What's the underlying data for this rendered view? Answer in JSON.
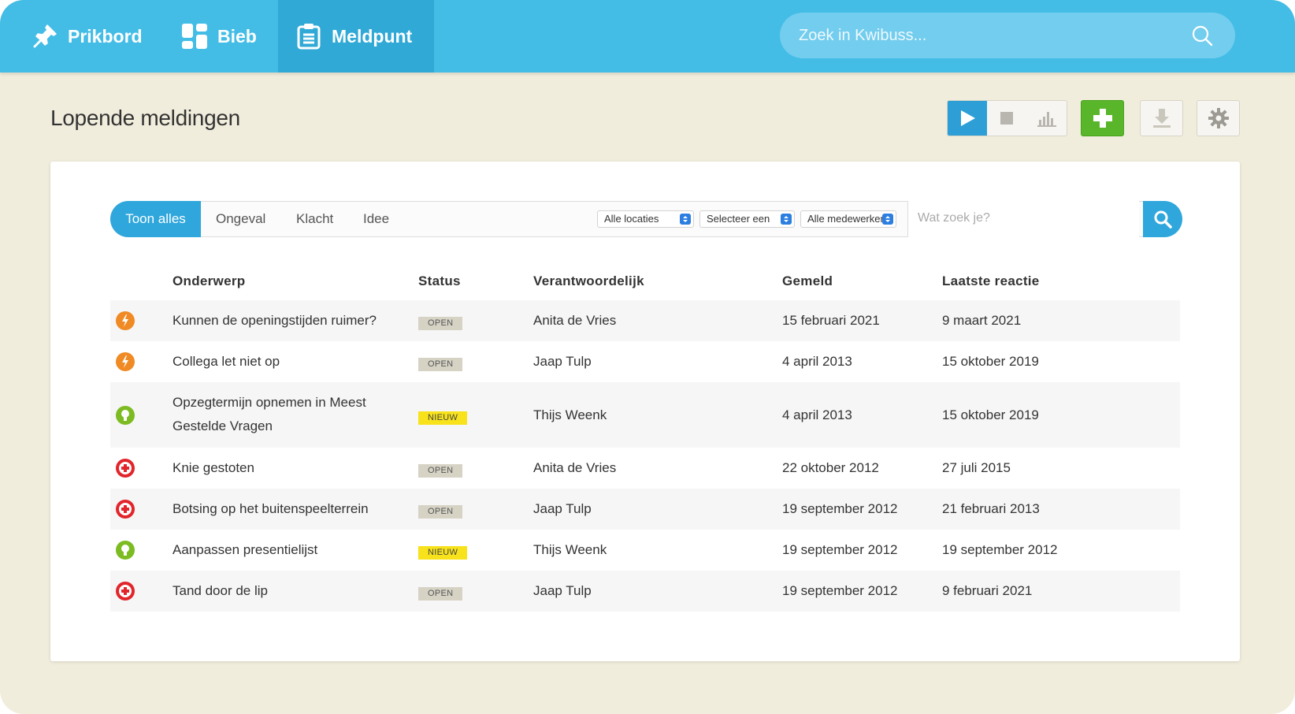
{
  "nav": {
    "items": [
      {
        "label": "Prikbord",
        "icon": "pushpin-icon"
      },
      {
        "label": "Bieb",
        "icon": "grid-icon"
      },
      {
        "label": "Meldpunt",
        "icon": "clipboard-icon",
        "active": true
      }
    ]
  },
  "search": {
    "placeholder": "Zoek in Kwibuss..."
  },
  "page": {
    "title": "Lopende meldingen"
  },
  "toolbar": {
    "view_buttons": [
      "play-icon",
      "stop-icon",
      "bar-chart-icon"
    ],
    "add_icon": "plus-icon",
    "download_icon": "download-icon",
    "settings_icon": "gear-icon"
  },
  "filters": {
    "tabs": [
      "Toon alles",
      "Ongeval",
      "Klacht",
      "Idee"
    ],
    "active_tab": "Toon alles",
    "selects": [
      "Alle locaties",
      "Selecteer een",
      "Alle medewerkers"
    ],
    "search_placeholder": "Wat zoek je?"
  },
  "table": {
    "headers": [
      "Onderwerp",
      "Status",
      "Verantwoordelijk",
      "Gemeld",
      "Laatste reactie"
    ],
    "rows": [
      {
        "type": "klacht",
        "subject": "Kunnen de openingstijden ruimer?",
        "status": "OPEN",
        "responsible": "Anita de Vries",
        "reported": "15 februari 2021",
        "last": "9 maart 2021"
      },
      {
        "type": "klacht",
        "subject": "Collega let niet op",
        "status": "OPEN",
        "responsible": "Jaap Tulp",
        "reported": "4 april 2013",
        "last": "15 oktober 2019"
      },
      {
        "type": "idee",
        "subject": "Opzegtermijn opnemen in Meest Gestelde Vragen",
        "status": "NIEUW",
        "responsible": "Thijs Weenk",
        "reported": "4 april 2013",
        "last": "15 oktober 2019"
      },
      {
        "type": "ongeval",
        "subject": "Knie gestoten",
        "status": "OPEN",
        "responsible": "Anita de Vries",
        "reported": "22 oktober 2012",
        "last": "27 juli 2015"
      },
      {
        "type": "ongeval",
        "subject": "Botsing op het buitenspeelterrein",
        "status": "OPEN",
        "responsible": "Jaap Tulp",
        "reported": "19 september 2012",
        "last": "21 februari 2013"
      },
      {
        "type": "idee",
        "subject": "Aanpassen presentielijst",
        "status": "NIEUW",
        "responsible": "Thijs Weenk",
        "reported": "19 september 2012",
        "last": "19 september 2012"
      },
      {
        "type": "ongeval",
        "subject": "Tand door de lip",
        "status": "OPEN",
        "responsible": "Jaap Tulp",
        "reported": "19 september 2012",
        "last": "9 februari 2021"
      }
    ]
  },
  "colors": {
    "topbar": "#44bde6",
    "accent": "#2fa7dc",
    "add": "#59b62a",
    "klacht": "#f08a24",
    "idee": "#7cbb21",
    "ongeval": "#e2252b",
    "nieuw": "#f7e21b",
    "open": "#d6d3c5"
  }
}
